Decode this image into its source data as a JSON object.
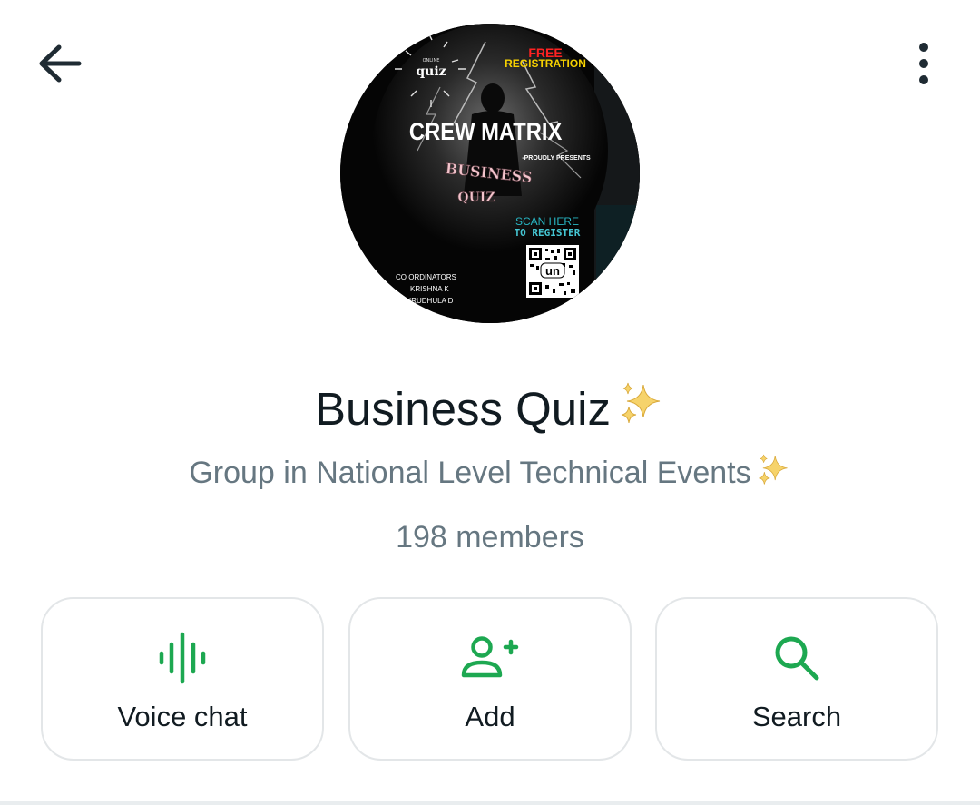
{
  "header": {
    "back_icon": "arrow-left-icon",
    "menu_icon": "more-vertical-icon"
  },
  "avatar": {
    "online_text": "ONLINE",
    "quiz_text": "quiz",
    "free_text": "FREE",
    "registration_text": "REGISTRATION",
    "crew_text": "CREW MATRIX",
    "proudly_text": "-PROUDLY PRESENTS",
    "business_text": "BUSINESS",
    "quiz2_text": "QUIZ",
    "scan_text": "SCAN HERE",
    "register_text": "TO REGISTER",
    "coordinators_text": "CO ORDINATORS",
    "name1": "KRISHNA K",
    "name2": "IRUDHULA D",
    "qr_text": "un"
  },
  "group": {
    "name": "Business Quiz",
    "subtitle": "Group in National Level Technical Events",
    "members": "198 members"
  },
  "actions": [
    {
      "label": "Voice chat",
      "icon": "voice-wave-icon"
    },
    {
      "label": "Add",
      "icon": "add-person-icon"
    },
    {
      "label": "Search",
      "icon": "search-icon"
    }
  ],
  "colors": {
    "accent": "#1da851",
    "text_primary": "#111b21",
    "text_secondary": "#667781",
    "border": "#e3e6e8"
  }
}
